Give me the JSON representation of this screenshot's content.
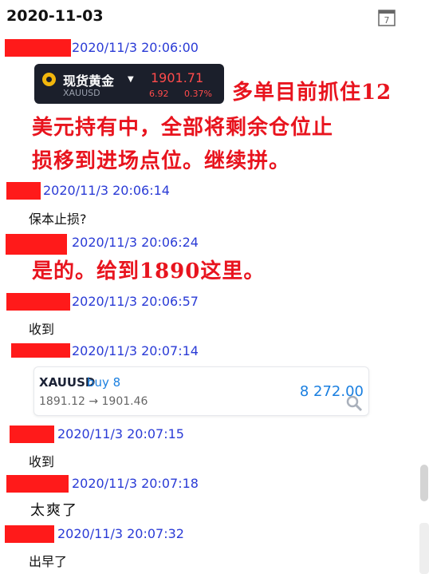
{
  "header": {
    "date": "2020-11-03",
    "calendar_day": "7"
  },
  "ticker": {
    "name": "现货黄金",
    "symbol": "XAUUSD",
    "price": "1901.71",
    "change": "6.92",
    "change_pct": "0.37%"
  },
  "messages": [
    {
      "ts": "2020/11/3 20:06:00"
    },
    {
      "ts": "2020/11/3 20:06:14",
      "text": "保本止损?"
    },
    {
      "ts": "2020/11/3 20:06:24"
    },
    {
      "ts": "2020/11/3 20:06:57",
      "text": "收到"
    },
    {
      "ts": "2020/11/3 20:07:14"
    },
    {
      "ts": "2020/11/3 20:07:15",
      "text": "收到"
    },
    {
      "ts": "2020/11/3 20:07:18",
      "text": "太爽了"
    },
    {
      "ts": "2020/11/3 20:07:32",
      "text": "出早了"
    }
  ],
  "reply1": {
    "line1": "多单目前抓住12",
    "line2": "美元持有中，全部将剩余仓位止",
    "line3": "损移到进场点位。继续拼。"
  },
  "reply2": "是的。给到1890这里。",
  "trade": {
    "symbol": "XAUUSD",
    "side": "buy 8",
    "range": "1891.12 → 1901.46",
    "profit": "8 272.00"
  },
  "colors": {
    "redaction": "#ff1a1a",
    "timestamp": "#2a3bd6",
    "highlight_text": "#e8141e",
    "profit": "#1a7fe0"
  }
}
